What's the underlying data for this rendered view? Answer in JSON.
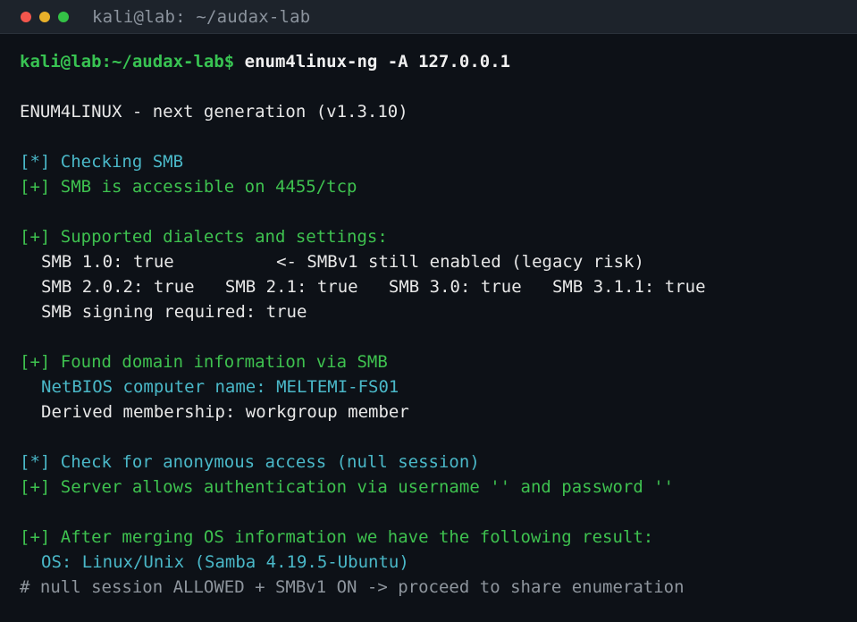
{
  "window": {
    "title": "kali@lab: ~/audax-lab",
    "controls": [
      "close",
      "minimize",
      "maximize"
    ]
  },
  "terminal": {
    "prompt": "kali@lab:~/audax-lab$",
    "command": " enum4linux-ng -A 127.0.0.1",
    "header": "ENUM4LINUX - next generation (v1.3.10)",
    "check_smb": "[*] Checking SMB",
    "smb_accessible": "[+] SMB is accessible on 4455/tcp",
    "dialects_header": "[+] Supported dialects and settings:",
    "dialect_line1": "SMB 1.0: true          <- SMBv1 still enabled (legacy risk)",
    "dialect_line2": "SMB 2.0.2: true   SMB 2.1: true   SMB 3.0: true   SMB 3.1.1: true",
    "signing": "SMB signing required: true",
    "domain_header": "[+] Found domain information via SMB",
    "netbios": "NetBIOS computer name: MELTEMI-FS01",
    "membership": "Derived membership: workgroup member",
    "anon_check": "[*] Check for anonymous access (null session)",
    "anon_result": "[+] Server allows authentication via username '' and password ''",
    "os_header": "[+] After merging OS information we have the following result:",
    "os_value": "OS: Linux/Unix (Samba 4.19.5-Ubuntu)",
    "note": "# null session ALLOWED + SMBv1 ON -> proceed to share enumeration"
  },
  "colors": {
    "background": "#0d1117",
    "prompt_green": "#38c352",
    "info_cyan": "#4ab8c8",
    "ok_green": "#3ec14f",
    "comment_gray": "#8e959d"
  }
}
